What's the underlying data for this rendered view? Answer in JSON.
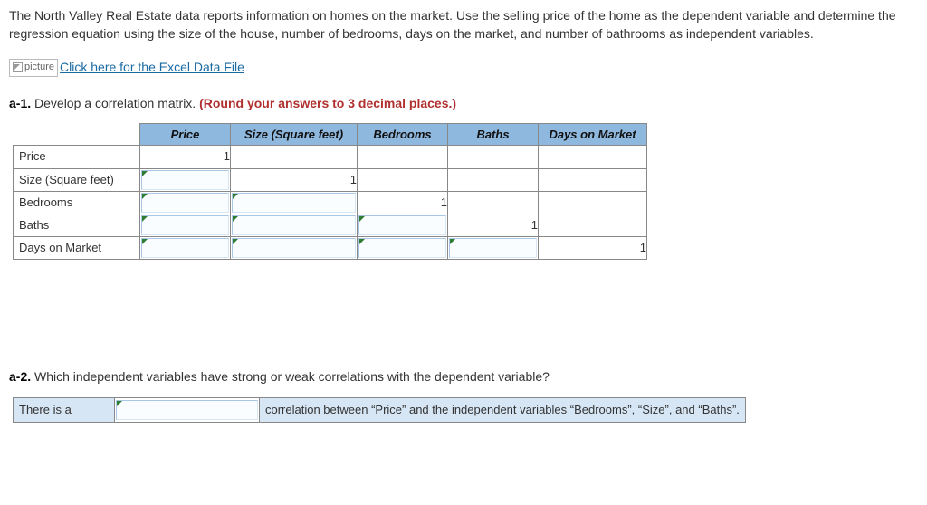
{
  "intro": "The North Valley Real Estate data reports information on homes on the market. Use the selling price of the home as the dependent variable and determine the regression equation using the size of the house, number of bedrooms, days on the market, and number of bathrooms as independent variables.",
  "excel": {
    "broken_alt": "picture",
    "link_text": "Click here for the Excel Data File"
  },
  "a1": {
    "label": "a-1.",
    "text": "Develop a correlation matrix.",
    "note": "(Round your answers to 3 decimal places.)"
  },
  "matrix": {
    "headers": [
      "Price",
      "Size (Square feet)",
      "Bedrooms",
      "Baths",
      "Days on Market"
    ],
    "rows": [
      {
        "label": "Price",
        "diag_col": 0,
        "inputs_before": []
      },
      {
        "label": "Size (Square feet)",
        "diag_col": 1,
        "inputs_before": [
          0
        ]
      },
      {
        "label": "Bedrooms",
        "diag_col": 2,
        "inputs_before": [
          0,
          1
        ]
      },
      {
        "label": "Baths",
        "diag_col": 3,
        "inputs_before": [
          0,
          1,
          2
        ]
      },
      {
        "label": "Days on Market",
        "diag_col": 4,
        "inputs_before": [
          0,
          1,
          2,
          3
        ]
      }
    ],
    "diag_value": "1"
  },
  "a2": {
    "label": "a-2.",
    "text": "Which independent variables have strong or weak correlations with the dependent variable?",
    "lead": "There is a",
    "tail": "correlation between “Price” and the independent variables “Bedrooms”, “Size”, and “Baths”."
  }
}
